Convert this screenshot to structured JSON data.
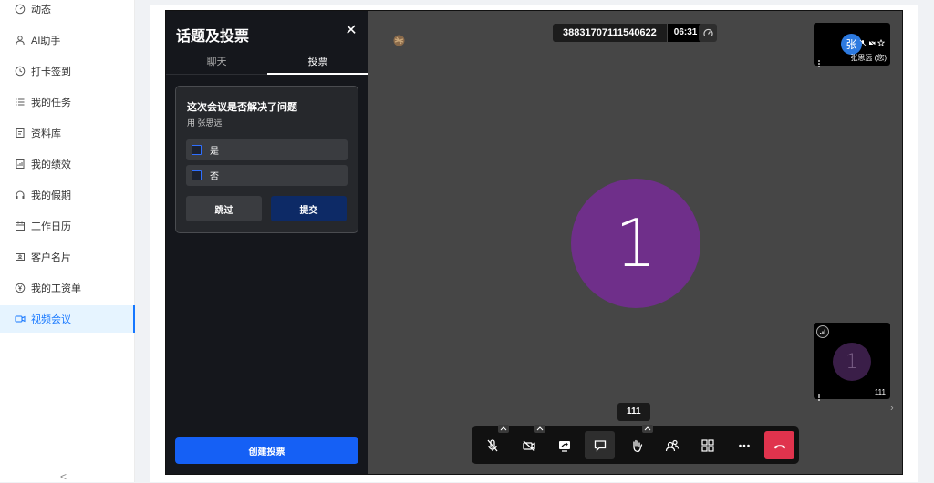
{
  "sidebar": {
    "items": [
      {
        "label": "动态",
        "icon": "dashboard-icon"
      },
      {
        "label": "AI助手",
        "icon": "user-icon"
      },
      {
        "label": "打卡签到",
        "icon": "clock-icon"
      },
      {
        "label": "我的任务",
        "icon": "list-icon"
      },
      {
        "label": "资料库",
        "icon": "document-icon"
      },
      {
        "label": "我的绩效",
        "icon": "report-icon"
      },
      {
        "label": "我的假期",
        "icon": "headphones-icon"
      },
      {
        "label": "工作日历",
        "icon": "calendar-icon"
      },
      {
        "label": "客户名片",
        "icon": "contact-card-icon"
      },
      {
        "label": "我的工资单",
        "icon": "yen-icon"
      },
      {
        "label": "视频会议",
        "icon": "video-icon",
        "active": true
      }
    ],
    "collapse_glyph": "<"
  },
  "panel": {
    "title": "话题及投票",
    "tabs": [
      {
        "label": "聊天"
      },
      {
        "label": "投票",
        "active": true
      }
    ],
    "poll": {
      "question": "这次会议是否解决了问题",
      "author": "用 张思远",
      "options": [
        {
          "label": "是"
        },
        {
          "label": "否"
        }
      ],
      "skip_label": "跳过",
      "submit_label": "提交"
    },
    "create_label": "创建投票"
  },
  "stage": {
    "room_id": "38831707111540622",
    "timer": "06:31",
    "main_avatar_text": "1",
    "main_avatar_color": "#6f2f8a",
    "current_speaker": "111"
  },
  "tiles": [
    {
      "avatar_text": "张",
      "name": "张思远 (您)"
    },
    {
      "avatar_text": "1",
      "name": "111"
    }
  ],
  "colors": {
    "accent": "#1560f5",
    "hangup": "#e0334d",
    "sidebar_active": "#1677ff"
  }
}
